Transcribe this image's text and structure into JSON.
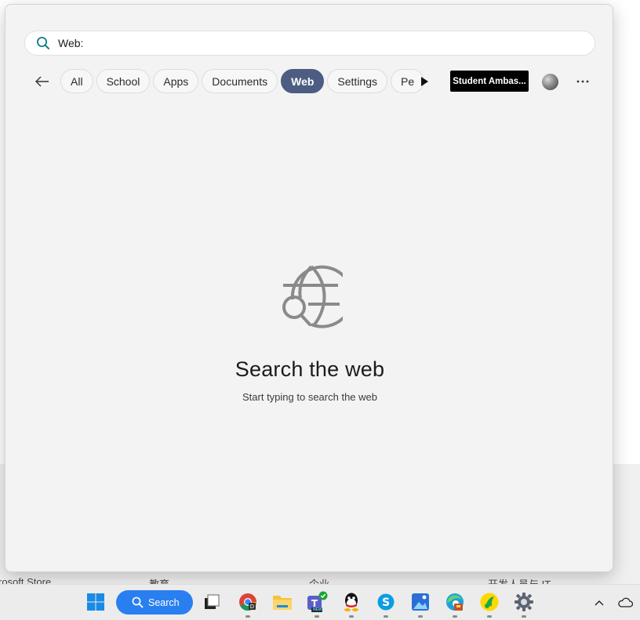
{
  "search": {
    "query": "Web:",
    "placeholder": ""
  },
  "filters": {
    "items": [
      "All",
      "School",
      "Apps",
      "Documents",
      "Web",
      "Settings",
      "Pe"
    ],
    "active": "Web"
  },
  "account": {
    "org_label": "Student Ambas..."
  },
  "empty_state": {
    "title": "Search the web",
    "subtitle": "Start typing to search the web",
    "icon": "globe-search-icon"
  },
  "taskbar": {
    "search_label": "Search",
    "apps": [
      "windows-start-icon",
      "task-view-icon",
      "chrome-icon",
      "file-explorer-icon",
      "teams-new-icon",
      "qq-icon",
      "skype-icon",
      "photos-icon",
      "edge-icon",
      "qq-music-icon",
      "settings-gear-icon"
    ],
    "teams_badge": "NEW"
  },
  "background": {
    "strip_text": [
      "rosoft Store",
      "教育",
      "企业",
      "开发人员与 IT"
    ]
  },
  "colors": {
    "active_chip": "#4c5c82",
    "taskbar_search": "#2a7ff0",
    "search_icon": "#0f7b8c"
  }
}
